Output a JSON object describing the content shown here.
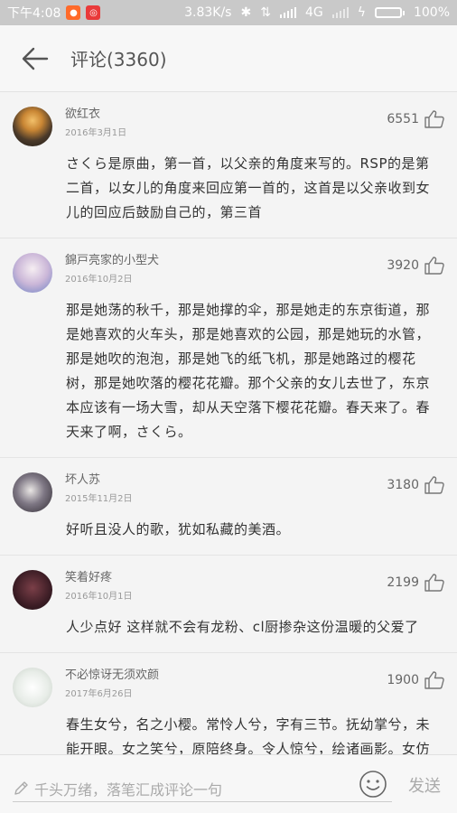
{
  "status_bar": {
    "time": "下午4:08",
    "network_speed": "3.83K/s",
    "network_type": "4G",
    "battery": "100%",
    "battery_level": 1.0
  },
  "header": {
    "title": "评论(3360)"
  },
  "comments": [
    {
      "username": "欲红衣",
      "date": "2016年3月1日",
      "likes": "6551",
      "text": "さくら是原曲，第一首，以父亲的角度来写的。RSP的是第二首，以女儿的角度来回应第一首的，这首是以父亲收到女儿的回应后鼓励自己的，第三首"
    },
    {
      "username": "錦戸亮家的小型犬",
      "date": "2016年10月2日",
      "likes": "3920",
      "text": "那是她荡的秋千，那是她撑的伞，那是她走的东京街道，那是她喜欢的火车头，那是她喜欢的公园，那是她玩的水管，那是她吹的泡泡，那是她飞的纸飞机，那是她路过的樱花树，那是她吹落的樱花花瓣。那个父亲的女儿去世了，东京本应该有一场大雪，却从天空落下樱花花瓣。春天来了。春天来了啊，さくら。"
    },
    {
      "username": "坏人苏",
      "date": "2015年11月2日",
      "likes": "3180",
      "text": "好听且没人的歌，犹如私藏的美酒。"
    },
    {
      "username": "笑着好疼",
      "date": "2016年10月1日",
      "likes": "2199",
      "text": "人少点好 这样就不会有龙粉、cl厨掺杂这份温暖的父爱了"
    },
    {
      "username": "不必惊讶无须欢颜",
      "date": "2017年6月26日",
      "likes": "1900",
      "text": "春生女兮，名之小樱。常怜人兮，字有三节。抚幼掌兮，未能开眼。女之笑兮，原陪终身。令人惊兮，绘诸画影。女仿吾兮，心甚欢喜。视女形兮，言笑更甚。五月风兮，堤防逐戏。六月雨兮，高台逐萤。八月暄兮，流漂萤虹。"
    }
  ],
  "input_bar": {
    "placeholder": "千头万绪，落笔汇成评论一句",
    "send_label": "发送"
  },
  "colors": {
    "status_bar_bg": "#c9c9c9",
    "battery_green": "#3bd13b",
    "text_primary": "#333333",
    "text_muted": "#999999"
  }
}
